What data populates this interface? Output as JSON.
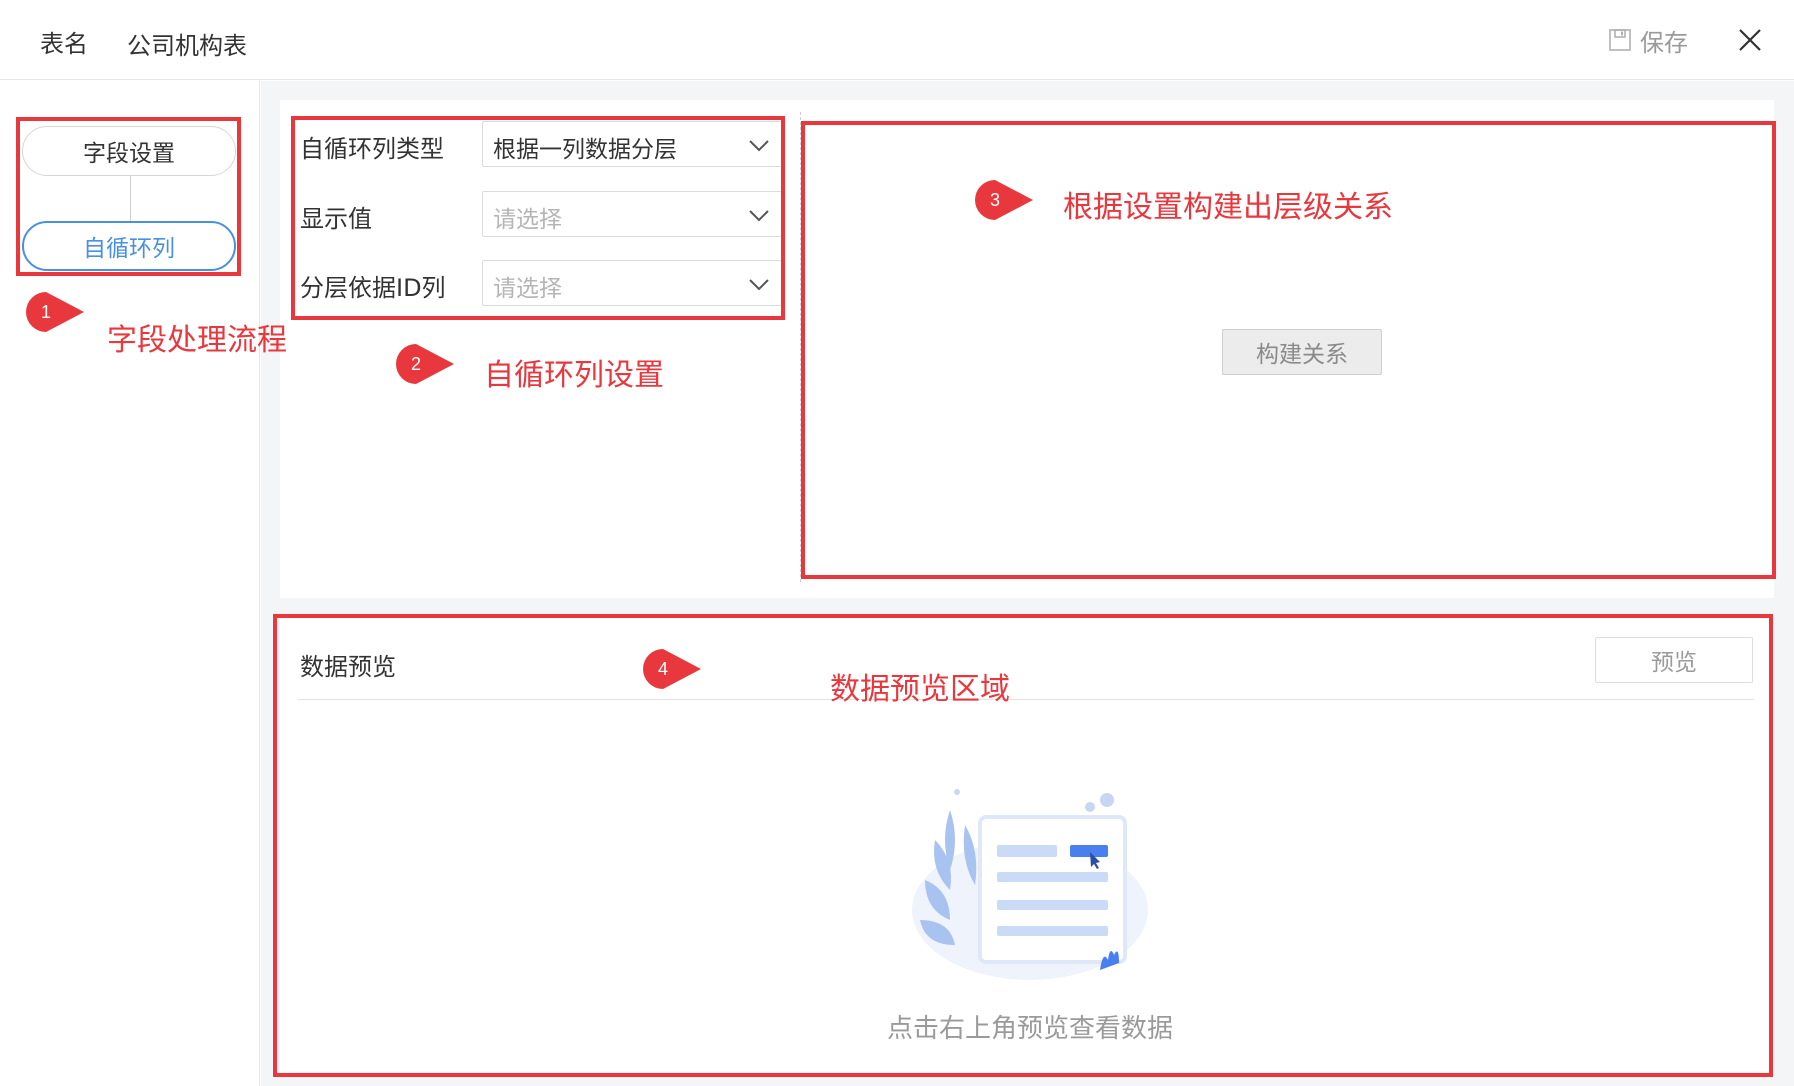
{
  "header": {
    "table_label": "表名",
    "table_name": "公司机构表",
    "save_label": "保存"
  },
  "sidebar": {
    "steps": [
      {
        "label": "字段设置"
      },
      {
        "label": "自循环列"
      }
    ]
  },
  "config": {
    "fields": [
      {
        "label": "自循环列类型",
        "value": "根据一列数据分层"
      },
      {
        "label": "显示值",
        "placeholder": "请选择"
      },
      {
        "label": "分层依据ID列",
        "placeholder": "请选择"
      }
    ],
    "build_button": "构建关系"
  },
  "preview": {
    "title": "数据预览",
    "button": "预览",
    "empty_text": "点击右上角预览查看数据"
  },
  "annotations": [
    {
      "number": "1",
      "text": "字段处理流程"
    },
    {
      "number": "2",
      "text": "自循环列设置"
    },
    {
      "number": "3",
      "text": "根据设置构建出层级关系"
    },
    {
      "number": "4",
      "text": "数据预览区域"
    }
  ],
  "colors": {
    "annotation_red": "#e8373d",
    "accent_blue": "#4a90e2",
    "border_gray": "#dcdcdc"
  },
  "icons": {
    "save": "save-icon",
    "close": "close-icon",
    "dropdown": "chevron-down-icon",
    "empty": "empty-state-illustration"
  }
}
